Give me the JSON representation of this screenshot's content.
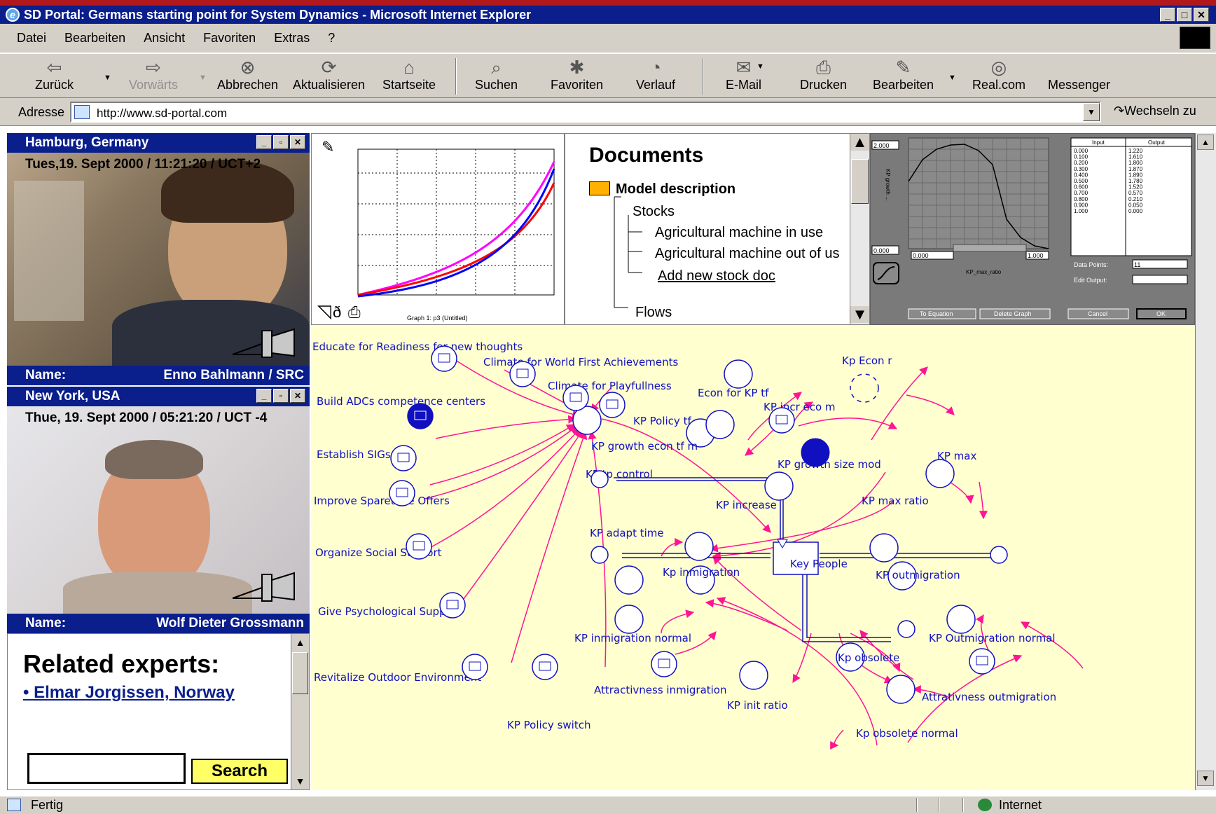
{
  "window": {
    "title": "SD Portal: Germans starting point for System Dynamics - Microsoft Internet Explorer"
  },
  "menu": [
    "Datei",
    "Bearbeiten",
    "Ansicht",
    "Favoriten",
    "Extras",
    "?"
  ],
  "toolbar": {
    "back": "Zurück",
    "forward": "Vorwärts",
    "stop": "Abbrechen",
    "refresh": "Aktualisieren",
    "home": "Startseite",
    "search": "Suchen",
    "favorites": "Favoriten",
    "history": "Verlauf",
    "mail": "E-Mail",
    "print": "Drucken",
    "edit": "Bearbeiten",
    "realcom": "Real.com",
    "messenger": "Messenger"
  },
  "address": {
    "label": "Adresse",
    "url": "http://www.sd-portal.com",
    "go": "Wechseln zu"
  },
  "video1": {
    "location": "Hamburg, Germany",
    "timestamp": "Tues,19. Sept 2000 / 11:21:20 / UCT+2",
    "name_label": "Name:",
    "name": "Enno Bahlmann / SRC"
  },
  "video2": {
    "location": "New York, USA",
    "timestamp": "Thue, 19. Sept 2000 / 05:21:20 / UCT -4",
    "name_label": "Name:",
    "name": "Wolf Dieter Grossmann"
  },
  "related": {
    "heading": "Related experts:",
    "expert": "Elmar Jorgissen, Norway",
    "search_label": "Search",
    "search_value": ""
  },
  "graph_caption": "Graph 1: p3 (Untitled)",
  "documents": {
    "title": "Documents",
    "root": "Model description",
    "stocks": "Stocks",
    "item1": "Agricultural machine in use",
    "item2": "Agricultural machine out of us",
    "add_link": "Add new stock doc",
    "flows": "Flows"
  },
  "lookup": {
    "ymax": "2.000",
    "ymin": "0.000",
    "xmin": "0.000",
    "xmax": "1.000",
    "yaxis": "KP growth ...",
    "xaxis": "KP_max_ratio",
    "col_input": "Input",
    "col_output": "Output",
    "inputs": [
      "0.000",
      "0.100",
      "0.200",
      "0.300",
      "0.400",
      "0.500",
      "0.600",
      "0.700",
      "0.800",
      "0.900",
      "1.000"
    ],
    "outputs": [
      "1.220",
      "1.610",
      "1.800",
      "1.870",
      "1.890",
      "1.780",
      "1.520",
      "0.570",
      "0.210",
      "0.050",
      "0.000"
    ],
    "data_points_label": "Data Points:",
    "data_points": "11",
    "edit_output_label": "Edit Output:",
    "buttons": [
      "To Equation",
      "Delete Graph",
      "Cancel",
      "OK"
    ]
  },
  "diagram": {
    "labels": {
      "educate": "Educate for Readiness for new thoughts",
      "climate_first": "Climate for World First Achievements",
      "climate_play": "Climate for Playfullness",
      "build_adc": "Build ADCs competence centers",
      "kp_policy_tf": "KP Policy tf",
      "kp_growth_econ": "KP growth econ tf m",
      "establish_sigs": "Establish SIGs",
      "kp_tp_control": "KP tp control",
      "improve_spare": "Improve Sparetime Offers",
      "organize_social": "Organize Social Support",
      "give_psych": "Give Psychological Support",
      "revitalize": "Revitalize Outdoor Environment",
      "kp_policy_switch": "KP Policy switch",
      "econ_kp_tf": "Econ for KP tf",
      "kp_incr_eco": "KP incr eco m",
      "kp_econ_r": "Kp Econ r",
      "kp_growth_size": "KP growth size mod",
      "kp_max": "KP max",
      "kp_max_ratio": "KP max ratio",
      "kp_increase": "KP increase",
      "kp_adapt_time": "KP adapt time",
      "key_people": "Key People",
      "kp_inmigration": "Kp inmigration",
      "kp_outmigration": "KP outmigration",
      "kp_inmig_normal": "KP inmigration normal",
      "kp_outmig_normal": "KP Outmigration normal",
      "kp_obsolete": "Kp obsolete",
      "attr_inmig": "Attractivness inmigration",
      "attr_outmig": "Attrativness outmigration",
      "kp_init_ratio": "KP init ratio",
      "kp_obs_normal": "Kp obsolete normal"
    }
  },
  "status": {
    "text": "Fertig",
    "zone": "Internet"
  },
  "colors": {
    "titlebar": "#0a1f8c",
    "accent": "#b0181b",
    "chrome": "#d4d0c8",
    "diagram_bg": "#ffffd0",
    "link_arrow": "#ff1493",
    "node": "#1010c0"
  }
}
